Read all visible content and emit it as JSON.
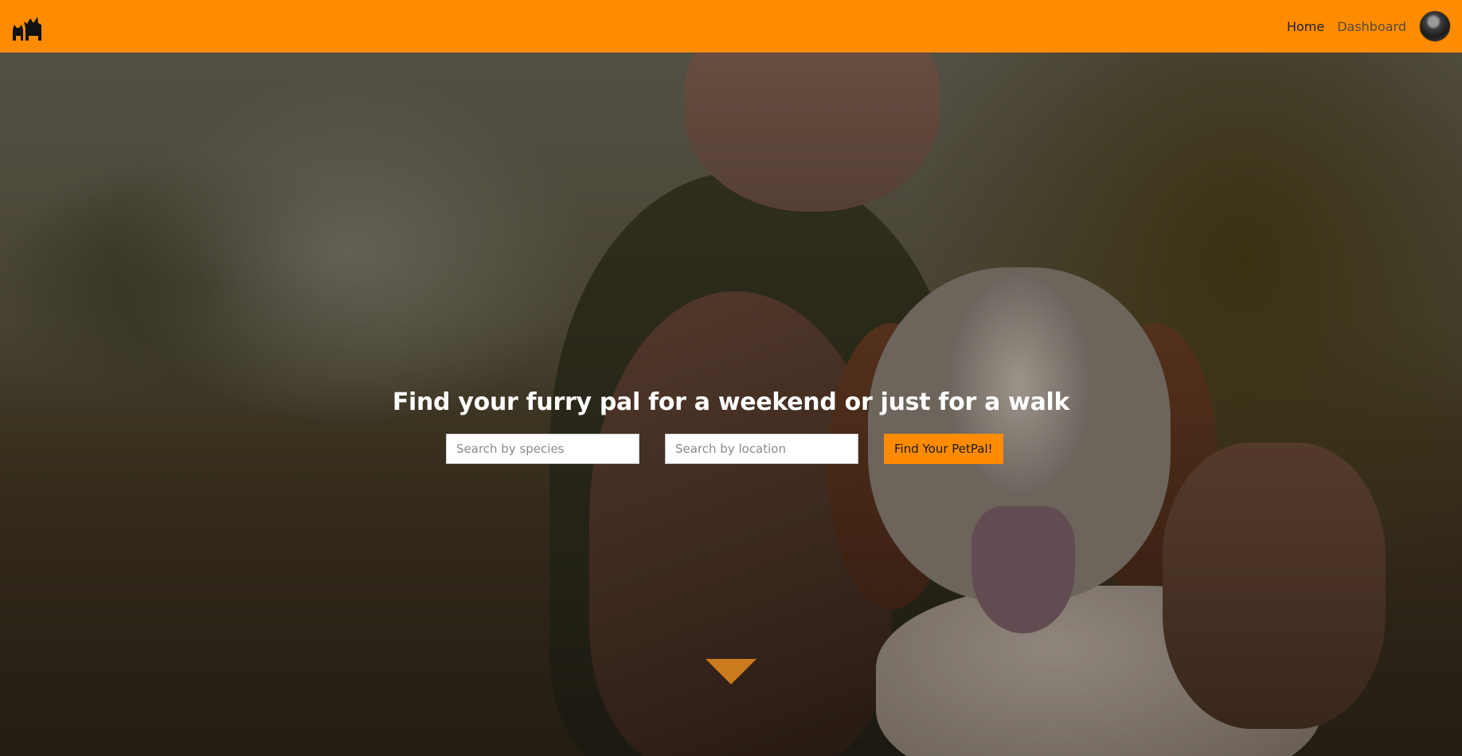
{
  "brand": {
    "logo_icon": "cat-and-dog-silhouette-icon"
  },
  "nav": {
    "home_label": "Home",
    "dashboard_label": "Dashboard",
    "avatar_icon": "user-avatar"
  },
  "hero": {
    "headline": "Find your furry pal for a weekend or just for a walk",
    "species_placeholder": "Search by species",
    "location_placeholder": "Search by location",
    "find_button_label": "Find Your PetPal!",
    "scroll_icon": "down-triangle-icon"
  },
  "colors": {
    "accent": "#ff8c00",
    "arrow": "#cc7a1e"
  }
}
